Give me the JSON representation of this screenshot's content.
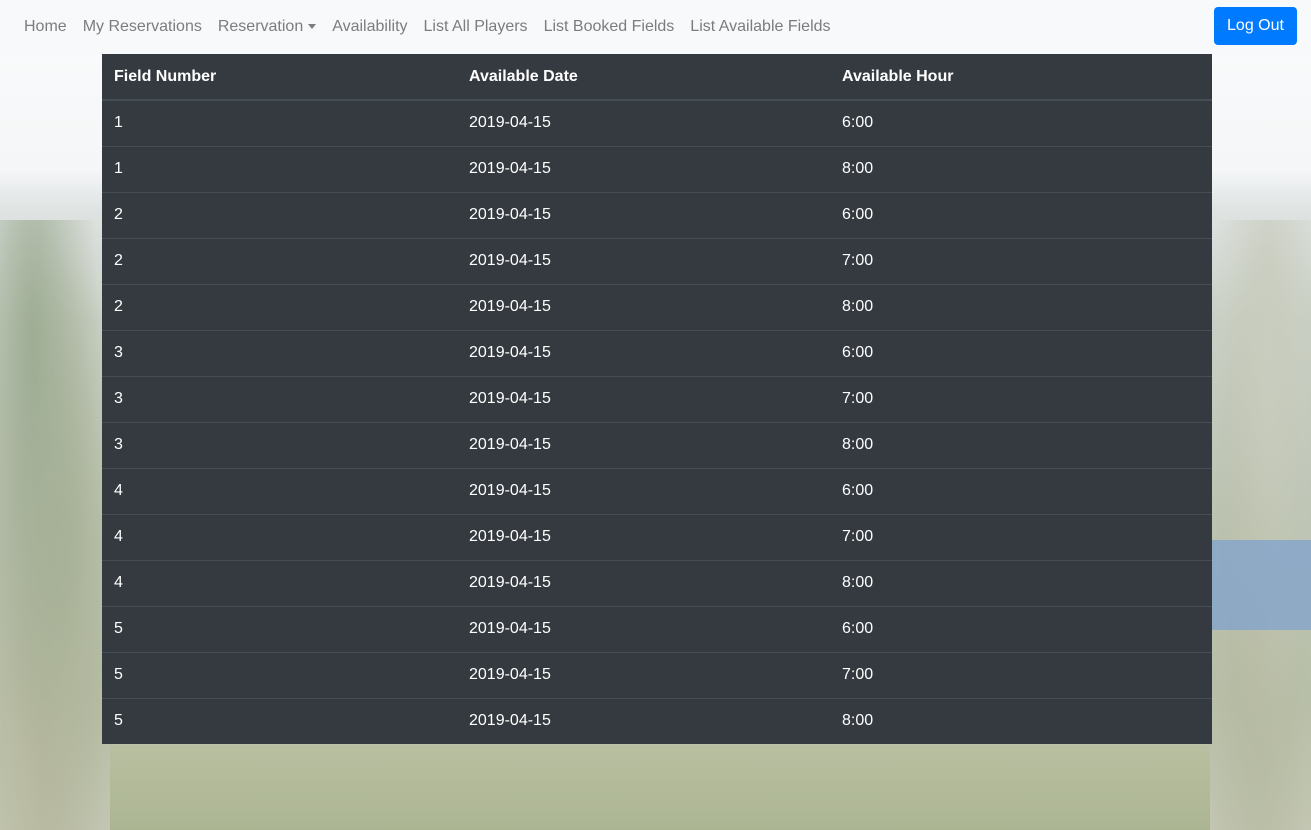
{
  "navbar": {
    "items": [
      {
        "label": "Home"
      },
      {
        "label": "My Reservations"
      },
      {
        "label": "Reservation"
      },
      {
        "label": "Availability"
      },
      {
        "label": "List All Players"
      },
      {
        "label": "List Booked Fields"
      },
      {
        "label": "List Available Fields"
      }
    ],
    "logout_label": "Log Out"
  },
  "table": {
    "headers": [
      "Field Number",
      "Available Date",
      "Available Hour"
    ],
    "rows": [
      [
        "1",
        "2019-04-15",
        "6:00"
      ],
      [
        "1",
        "2019-04-15",
        "8:00"
      ],
      [
        "2",
        "2019-04-15",
        "6:00"
      ],
      [
        "2",
        "2019-04-15",
        "7:00"
      ],
      [
        "2",
        "2019-04-15",
        "8:00"
      ],
      [
        "3",
        "2019-04-15",
        "6:00"
      ],
      [
        "3",
        "2019-04-15",
        "7:00"
      ],
      [
        "3",
        "2019-04-15",
        "8:00"
      ],
      [
        "4",
        "2019-04-15",
        "6:00"
      ],
      [
        "4",
        "2019-04-15",
        "7:00"
      ],
      [
        "4",
        "2019-04-15",
        "8:00"
      ],
      [
        "5",
        "2019-04-15",
        "6:00"
      ],
      [
        "5",
        "2019-04-15",
        "7:00"
      ],
      [
        "5",
        "2019-04-15",
        "8:00"
      ]
    ]
  },
  "colors": {
    "navbar_bg": "#f8f9fa",
    "nav_link": "#7a7d80",
    "primary": "#007bff",
    "table_bg": "#343a40",
    "table_border": "#454d55"
  }
}
